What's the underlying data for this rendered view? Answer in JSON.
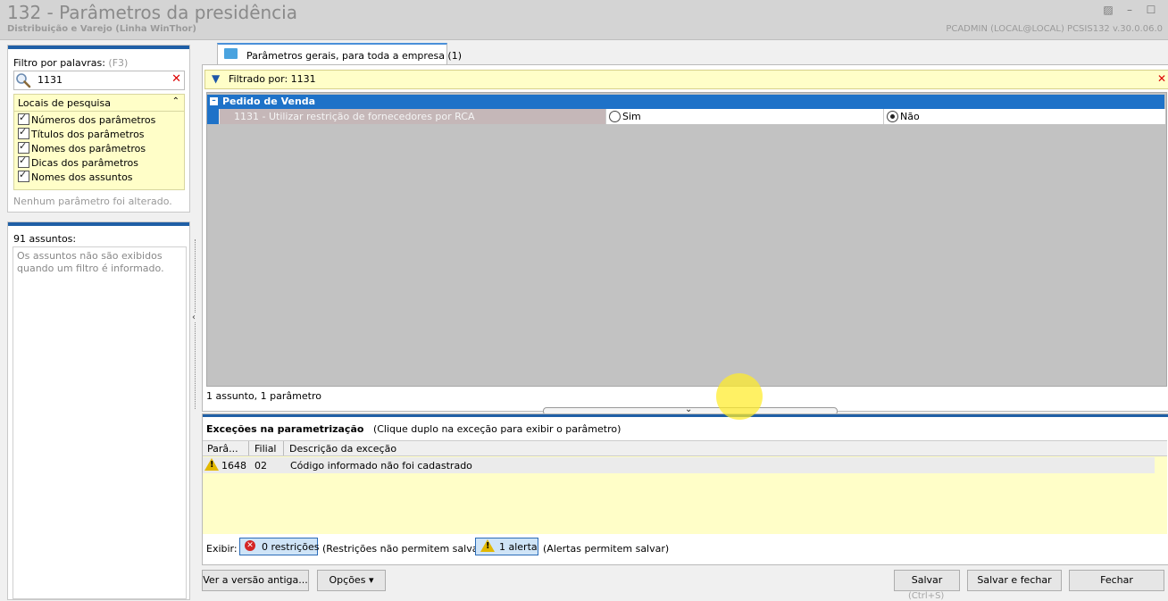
{
  "window": {
    "title": "132 - Parâmetros da presidência",
    "subtitle": "Distribuição e Varejo (Linha WinThor)",
    "user_info": "PCADMIN (LOCAL@LOCAL)   PCSIS132  v.30.0.06.0"
  },
  "filter": {
    "label": "Filtro por palavras:",
    "hint": "(F3)",
    "search_value": "1131",
    "locais_title": "Locais de pesquisa",
    "options": [
      {
        "label": "Números dos parâmetros",
        "checked": true
      },
      {
        "label": "Títulos dos parâmetros",
        "checked": true
      },
      {
        "label": "Nomes dos parâmetros",
        "checked": true
      },
      {
        "label": "Dicas dos parâmetros",
        "checked": true
      },
      {
        "label": "Nomes dos assuntos",
        "checked": true
      }
    ],
    "no_change": "Nenhum parâmetro foi alterado."
  },
  "assuntos": {
    "count": "91 assuntos:",
    "message": "Os assuntos não são exibidos quando um filtro é informado."
  },
  "tab": {
    "label": "Parâmetros gerais, para toda a empresa  (1)"
  },
  "filter_bar": {
    "label": "Filtrado por: 1131"
  },
  "group": {
    "label": "Pedido de Venda",
    "param": {
      "name": "1131 - Utilizar restrição de fornecedores por RCA",
      "option_yes": "Sim",
      "option_no": "Não",
      "selected": "Não"
    }
  },
  "status": "1 assunto, 1 parâmetro",
  "exceptions": {
    "title": "Exceções na parametrização",
    "hint": "(Clique duplo na exceção para exibir o parâmetro)",
    "columns": [
      "Parâ...",
      "Filial",
      "Descrição da exceção"
    ],
    "rows": [
      {
        "param": "1648",
        "filial": "02",
        "descricao": "Código informado não foi cadastrado",
        "type": "alerta"
      }
    ],
    "exibir": "Exibir:",
    "restricoes_btn": "0 restrições",
    "restricoes_note": "(Restrições não permitem salvar)",
    "alertas_btn": "1 alerta",
    "alertas_note": "(Alertas permitem salvar)"
  },
  "buttons": {
    "old_version": "Ver a versão antiga...",
    "options": "Opções",
    "save": "Salvar",
    "save_close": "Salvar e fechar",
    "close": "Fechar",
    "save_shortcut": "(Ctrl+S)"
  },
  "colors": {
    "group_header": "#1e72c8",
    "panel_accent": "#1f5fa6",
    "highlight_yellow": "#fffec8"
  }
}
